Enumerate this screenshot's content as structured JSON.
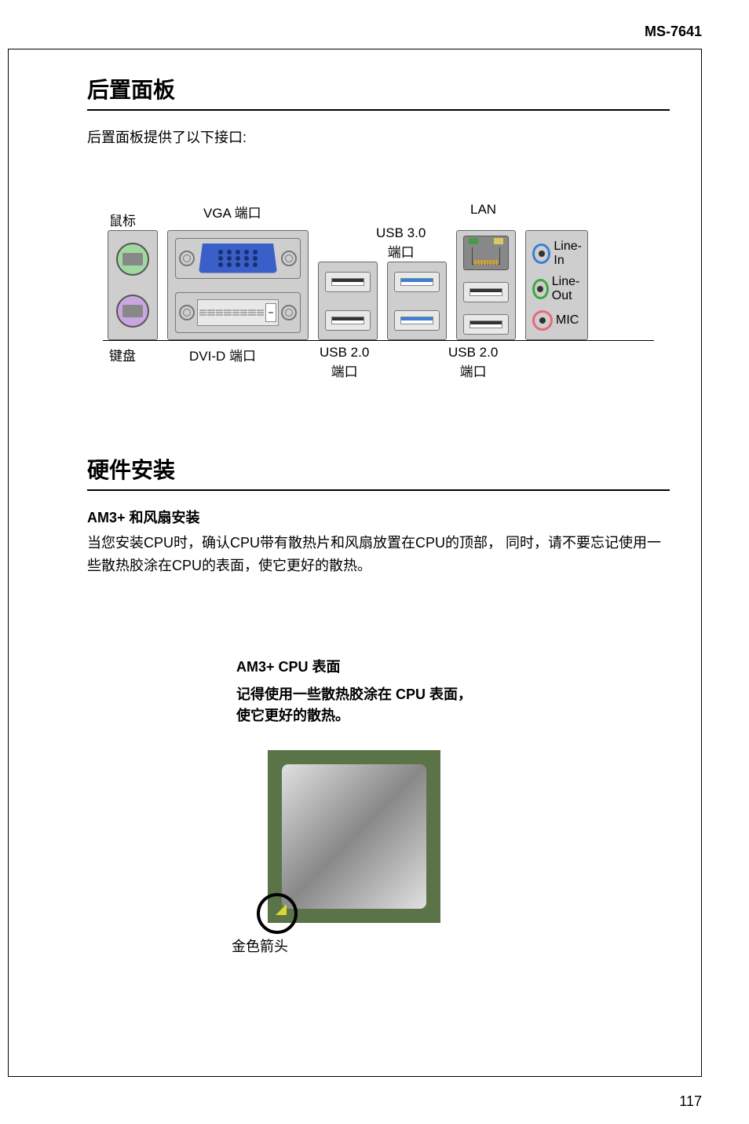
{
  "model": "MS-7641",
  "page_number": "117",
  "section1": {
    "title": "后置面板",
    "intro": "后置面板提供了以下接口:"
  },
  "ports": {
    "mouse": "鼠标",
    "keyboard": "键盘",
    "vga": "VGA 端口",
    "dvid": "DVI-D 端口",
    "usb30": "USB 3.0",
    "usb30_sub": "端口",
    "usb20": "USB 2.0",
    "usb20_sub": "端口",
    "lan": "LAN",
    "linein": "Line-In",
    "lineout": "Line-Out",
    "mic": "MIC"
  },
  "section2": {
    "title": "硬件安装",
    "subheading": "AM3+ 和风扇安装",
    "body": "当您安装CPU时，确认CPU带有散热片和风扇放置在CPU的顶部，  同时，请不要忘记使用一些散热胶涂在CPU的表面，使它更好的散热。"
  },
  "cpu": {
    "title": "AM3+ CPU 表面",
    "note1": "记得使用一些散热胶涂在 CPU 表面，",
    "note2": "使它更好的散热。",
    "arrow_label": "金色箭头"
  }
}
